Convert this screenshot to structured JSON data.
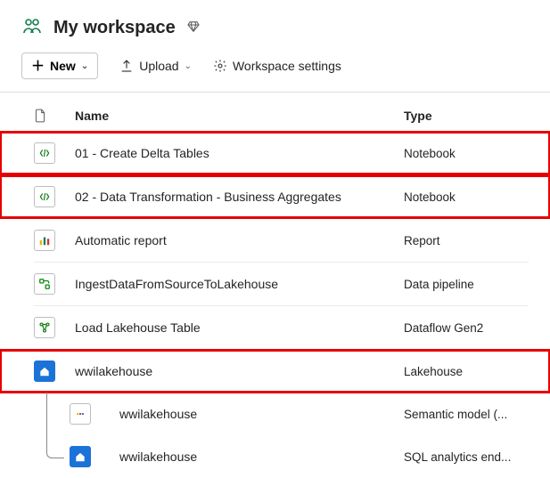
{
  "header": {
    "title": "My workspace"
  },
  "toolbar": {
    "new_label": "New",
    "upload_label": "Upload",
    "settings_label": "Workspace settings"
  },
  "columns": {
    "name": "Name",
    "type": "Type"
  },
  "items": [
    {
      "name": "01 - Create Delta Tables",
      "type": "Notebook",
      "icon": "notebook",
      "hl": true
    },
    {
      "name": "02 - Data Transformation - Business Aggregates",
      "type": "Notebook",
      "icon": "notebook",
      "hl": true
    },
    {
      "name": "Automatic report",
      "type": "Report",
      "icon": "report",
      "hl": false
    },
    {
      "name": "IngestDataFromSourceToLakehouse",
      "type": "Data pipeline",
      "icon": "pipeline",
      "hl": false
    },
    {
      "name": "Load Lakehouse Table",
      "type": "Dataflow Gen2",
      "icon": "dataflow",
      "hl": false
    },
    {
      "name": "wwilakehouse",
      "type": "Lakehouse",
      "icon": "lakehouse",
      "hl": true
    }
  ],
  "children": [
    {
      "name": "wwilakehouse",
      "type": "Semantic model (...",
      "icon": "semantic"
    },
    {
      "name": "wwilakehouse",
      "type": "SQL analytics end...",
      "icon": "sql"
    }
  ]
}
